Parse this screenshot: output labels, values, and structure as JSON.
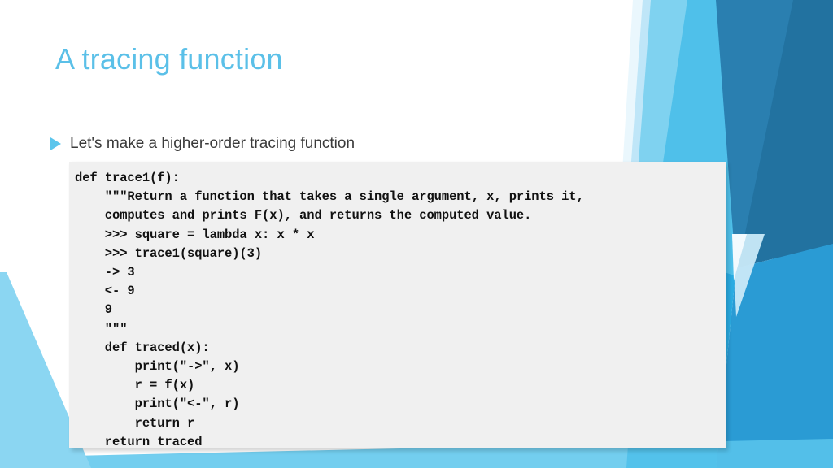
{
  "slide": {
    "title": "A tracing function",
    "title_color": "#5BC0E8",
    "background_color": "#FFFFFF"
  },
  "bullets": [
    {
      "marker": "triangle-right",
      "marker_color": "#5BC5EC",
      "text": "Let's make a higher-order tracing function"
    }
  ],
  "code_block": {
    "background_color": "#F0F0F0",
    "text_color": "#111111",
    "language": "python",
    "lines": [
      "def trace1(f):",
      "    \"\"\"Return a function that takes a single argument, x, prints it,",
      "    computes and prints F(x), and returns the computed value.",
      "    >>> square = lambda x: x * x",
      "    >>> trace1(square)(3)",
      "    -> 3",
      "    <- 9",
      "    9",
      "    \"\"\"",
      "    def traced(x):",
      "        print(\"->\", x)",
      "        r = f(x)",
      "        print(\"<-\", r)",
      "        return r",
      "    return traced"
    ]
  },
  "decoration": {
    "palette": {
      "dark_blue": "#2272A0",
      "mid_blue": "#2A9BD4",
      "bright_blue": "#29ABE2",
      "light_blue": "#5BC5EC",
      "pale_blue": "#8BD6F2",
      "very_pale_blue": "#C9E9F8",
      "near_white_blue": "#EAF7FD"
    }
  }
}
